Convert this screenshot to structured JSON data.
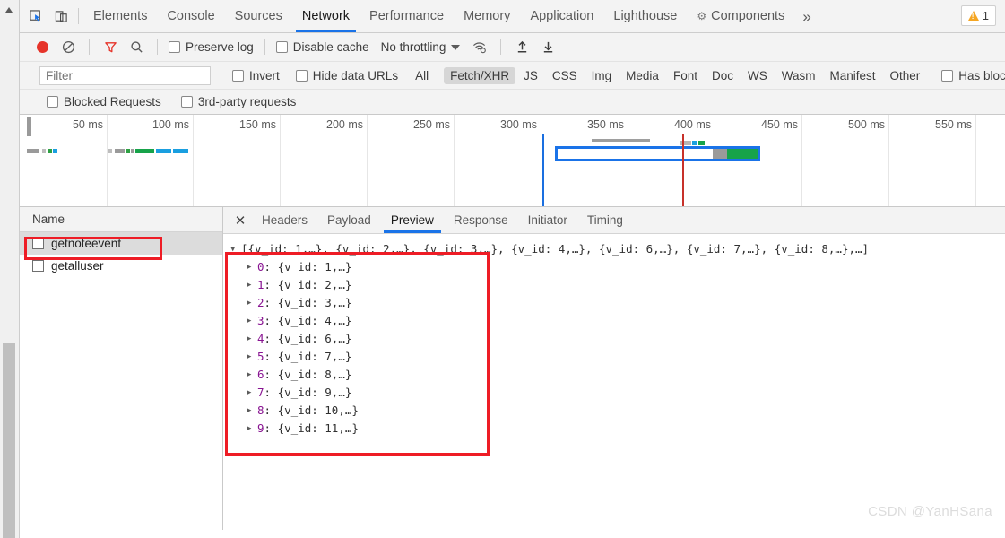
{
  "window": {
    "warning_badge": {
      "icon": "warning-triangle-icon",
      "count": "1"
    }
  },
  "main_tabs": {
    "inspect_icon": "inspect-element-icon",
    "device_icon": "device-toolbar-icon",
    "more_icon": "»",
    "items": [
      {
        "label": "Elements",
        "active": false
      },
      {
        "label": "Console",
        "active": false
      },
      {
        "label": "Sources",
        "active": false
      },
      {
        "label": "Network",
        "active": true
      },
      {
        "label": "Performance",
        "active": false
      },
      {
        "label": "Memory",
        "active": false
      },
      {
        "label": "Application",
        "active": false
      },
      {
        "label": "Lighthouse",
        "active": false
      },
      {
        "label": "Components",
        "active": false,
        "icon": "gear-icon"
      }
    ]
  },
  "controls": {
    "record_icon": "record-stop-icon",
    "clear_icon": "clear-network-log-icon",
    "filter_icon": "filter-funnel-icon",
    "search_icon": "search-icon",
    "preserve_log_label": "Preserve log",
    "disable_cache_label": "Disable cache",
    "throttling_value": "No throttling",
    "throttling_caret_icon": "chevron-down-icon",
    "wifi_icon": "network-conditions-icon",
    "import_icon": "import-har-icon",
    "export_icon": "export-har-icon"
  },
  "filter_bar": {
    "filter_placeholder": "Filter",
    "filter_value": "",
    "invert_label": "Invert",
    "hide_data_urls_label": "Hide data URLs",
    "types": [
      {
        "label": "All",
        "selected": false
      },
      {
        "label": "Fetch/XHR",
        "selected": true
      },
      {
        "label": "JS",
        "selected": false
      },
      {
        "label": "CSS",
        "selected": false
      },
      {
        "label": "Img",
        "selected": false
      },
      {
        "label": "Media",
        "selected": false
      },
      {
        "label": "Font",
        "selected": false
      },
      {
        "label": "Doc",
        "selected": false
      },
      {
        "label": "WS",
        "selected": false
      },
      {
        "label": "Wasm",
        "selected": false
      },
      {
        "label": "Manifest",
        "selected": false
      },
      {
        "label": "Other",
        "selected": false
      }
    ],
    "has_blocked_label": "Has blocked"
  },
  "blocked_bar": {
    "blocked_requests_label": "Blocked Requests",
    "third_party_label": "3rd-party requests"
  },
  "overview": {
    "ticks": [
      "50 ms",
      "100 ms",
      "150 ms",
      "200 ms",
      "250 ms",
      "300 ms",
      "350 ms",
      "400 ms",
      "450 ms",
      "500 ms",
      "550 ms"
    ],
    "dom_content_loaded_color": "#1a6fe0",
    "load_event_color": "#c7312a",
    "selection_border_color": "#1a73e8"
  },
  "requests_panel": {
    "column_header": "Name",
    "rows": [
      {
        "name": "getnoteevent",
        "selected": true,
        "annotated": true
      },
      {
        "name": "getalluser",
        "selected": false,
        "annotated": false
      }
    ]
  },
  "detail_panel": {
    "close_icon": "close-icon",
    "tabs": [
      {
        "label": "Headers",
        "active": false
      },
      {
        "label": "Payload",
        "active": false
      },
      {
        "label": "Preview",
        "active": true
      },
      {
        "label": "Response",
        "active": false
      },
      {
        "label": "Initiator",
        "active": false
      },
      {
        "label": "Timing",
        "active": false
      }
    ],
    "preview": {
      "root_expanded": true,
      "summary_prefix": "[",
      "summary_items": [
        "{v_id: 1,…}",
        "{v_id: 2,…}",
        "{v_id: 3,…}",
        "{v_id: 4,…}",
        "{v_id: 6,…}",
        "{v_id: 7,…}",
        "{v_id: 8,…}"
      ],
      "summary_suffix": ",…]",
      "entries": [
        {
          "index": "0",
          "value": "{v_id: 1,…}",
          "v_id": "1"
        },
        {
          "index": "1",
          "value": "{v_id: 2,…}",
          "v_id": "2"
        },
        {
          "index": "2",
          "value": "{v_id: 3,…}",
          "v_id": "3"
        },
        {
          "index": "3",
          "value": "{v_id: 4,…}",
          "v_id": "4"
        },
        {
          "index": "4",
          "value": "{v_id: 6,…}",
          "v_id": "6"
        },
        {
          "index": "5",
          "value": "{v_id: 7,…}",
          "v_id": "7"
        },
        {
          "index": "6",
          "value": "{v_id: 8,…}",
          "v_id": "8"
        },
        {
          "index": "7",
          "value": "{v_id: 9,…}",
          "v_id": "9"
        },
        {
          "index": "8",
          "value": "{v_id: 10,…}",
          "v_id": "10"
        },
        {
          "index": "9",
          "value": "{v_id: 11,…}",
          "v_id": "11"
        }
      ]
    }
  },
  "watermark": {
    "text": "CSDN @YanHSana"
  }
}
